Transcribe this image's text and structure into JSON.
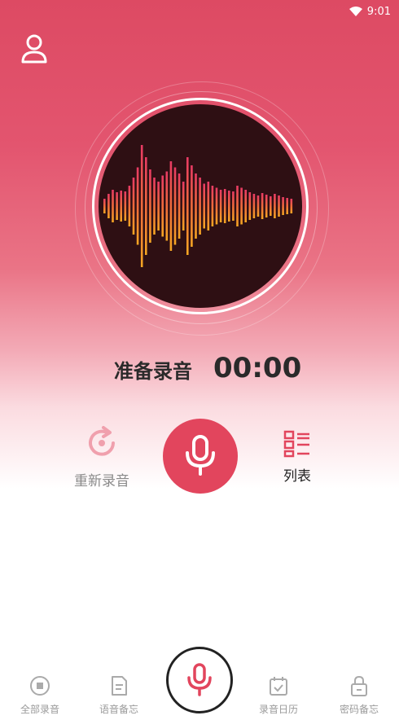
{
  "status_bar": {
    "time": "9:01",
    "wifi_icon": "wifi-icon"
  },
  "recorder": {
    "status_label": "准备录音",
    "timer": "00:00"
  },
  "controls": {
    "re_record_label": "重新录音",
    "record_icon": "microphone-icon",
    "list_label": "列表"
  },
  "tabs": [
    {
      "label": "全部录音",
      "icon": "record-dot-icon"
    },
    {
      "label": "语音备忘",
      "icon": "note-icon"
    },
    {
      "label": "",
      "icon": "microphone-icon"
    },
    {
      "label": "录音日历",
      "icon": "calendar-icon"
    },
    {
      "label": "密码备忘",
      "icon": "lock-icon"
    }
  ],
  "colors": {
    "accent": "#e2455d",
    "header_top": "#dd4a63",
    "disc": "#2e0f13",
    "wave_high": "#e83a64",
    "wave_low": "#f5a623"
  }
}
